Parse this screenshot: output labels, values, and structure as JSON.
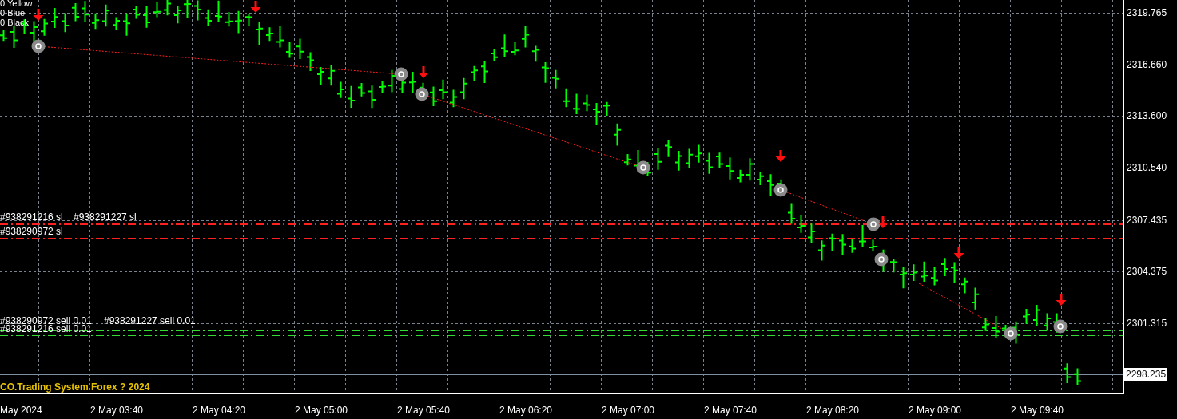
{
  "indicator_legend": [
    "0 Yellow",
    "0 Blue",
    "0 Black"
  ],
  "order_labels": [
    {
      "text": "#938291216 sl",
      "kind": "sl"
    },
    {
      "text": "#938291227 sl",
      "kind": "sl"
    },
    {
      "text": "#938290972 sl",
      "kind": "sl"
    },
    {
      "text": "#938290972 sell 0.01",
      "kind": "sell"
    },
    {
      "text": "#938291227 sell 0.01",
      "kind": "sell"
    },
    {
      "text": "#938291216 sell 0.01",
      "kind": "sell"
    }
  ],
  "footer_text": "CO.Trading System Forex  ? 2024",
  "price_axis": [
    "2319.765",
    "2316.660",
    "2313.600",
    "2310.540",
    "2307.435",
    "2304.375",
    "2301.315"
  ],
  "current_price": "2298.235",
  "time_axis": [
    "May 2024",
    "2 May 03:40",
    "2 May 04:20",
    "2 May 05:00",
    "2 May 05:40",
    "2 May 06:20",
    "2 May 07:00",
    "2 May 07:40",
    "2 May 08:20",
    "2 May 09:00",
    "2 May 09:40"
  ]
}
